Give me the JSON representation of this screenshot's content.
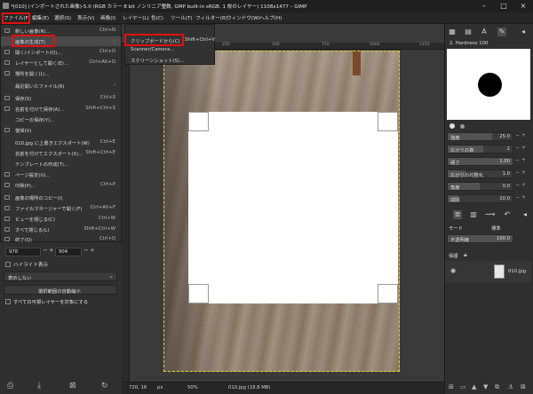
{
  "title": "*[010] (インポートされた画像)-5.0 (RGB カラー 8 bit ノンリニア整数, GMP built-in sRGB, 1 枚のレイヤー) 1108x1477 – GIMP",
  "menubar": [
    "ファイル(F)",
    "編集(E)",
    "選択(S)",
    "表示(V)",
    "画像(I)",
    "レイヤー(L)",
    "色(C)",
    "ツール(T)",
    "フィルター(R)",
    "ウィンドウ(W)",
    "ヘルプ(H)"
  ],
  "file_menu": [
    {
      "label": "新しい画像(N)...",
      "shortcut": "Ctrl+N"
    },
    {
      "label": "画像の生成(T)",
      "shortcut": "›"
    },
    {
      "label": "開く/インポート(O)...",
      "shortcut": "Ctrl+O"
    },
    {
      "label": "レイヤーとして開く(E)...",
      "shortcut": "Ctrl+Alt+O"
    },
    {
      "label": "場所を開く(L)...",
      "shortcut": ""
    },
    {
      "label": "最近開いたファイル(R)",
      "shortcut": "›"
    },
    {
      "label": "保存(S)",
      "shortcut": "Ctrl+S"
    },
    {
      "label": "名前を付けて保存(A)...",
      "shortcut": "Shift+Ctrl+S"
    },
    {
      "label": "コピーの保存(Y)...",
      "shortcut": ""
    },
    {
      "label": "復帰(V)",
      "shortcut": ""
    },
    {
      "label": "010.jpg に上書きエクスポート(W)",
      "shortcut": "Ctrl+E"
    },
    {
      "label": "名前を付けてエクスポート(X)...",
      "shortcut": "Shift+Ctrl+E"
    },
    {
      "label": "テンプレートの作成(T)...",
      "shortcut": ""
    },
    {
      "label": "ページ設定(U)...",
      "shortcut": ""
    },
    {
      "label": "印刷(P)...",
      "shortcut": "Ctrl+P"
    },
    {
      "label": "画像の場所のコピー(I)",
      "shortcut": ""
    },
    {
      "label": "ファイルマネージャーで開く(F)",
      "shortcut": "Ctrl+Alt+F"
    },
    {
      "label": "ビューを閉じる(C)",
      "shortcut": "Ctrl+W"
    },
    {
      "label": "すべて閉じる(L)",
      "shortcut": "Shift+Ctrl+W"
    },
    {
      "label": "終了(Q)",
      "shortcut": "Ctrl+Q"
    }
  ],
  "submenu": [
    {
      "label": "クリップボードから(C)",
      "shortcut": "Shift+Ctrl+V"
    },
    {
      "label": "Scanner/Camera...",
      "shortcut": ""
    },
    {
      "label": "スクリーンショット(S)...",
      "shortcut": ""
    }
  ],
  "tool_options": {
    "width": "978",
    "height": "904",
    "highlight": "ハイライト表示",
    "guides": "表示しない",
    "autoshrink": "選択範囲の自動縮小",
    "all_layers": "すべての可視レイヤーを対象にする"
  },
  "ruler_ticks": [
    "0",
    "250",
    "500",
    "750",
    "1000",
    "1250"
  ],
  "status": {
    "coords": "720, 16",
    "unit": "px",
    "zoom": "50%",
    "file": "010.jpg (18.8 MB)"
  },
  "brushes": {
    "name": "2. Hardness 100"
  },
  "tool_sliders": [
    {
      "label": "強度",
      "value": "25.0"
    },
    {
      "label": "広がりの数",
      "value": "2"
    },
    {
      "label": "硬さ",
      "value": "1.00"
    },
    {
      "label": "広がりの均整化",
      "value": "1.0"
    },
    {
      "label": "角度",
      "value": "0.0"
    },
    {
      "label": "間隔",
      "value": "10.0"
    }
  ],
  "layers": {
    "mode_label": "モード",
    "mode_value": "標準",
    "opacity_label": "不透明度",
    "opacity_value": "100.0",
    "lock_label": "保護",
    "layer_name": "010.jpg"
  }
}
